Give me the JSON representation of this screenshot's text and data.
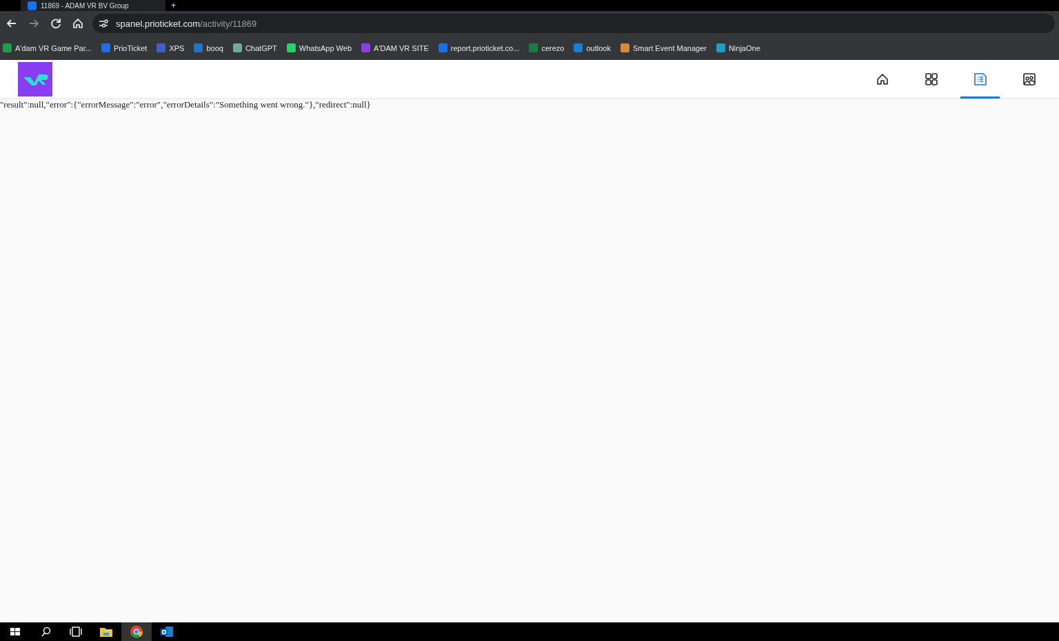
{
  "browser": {
    "tab_title": "11869 - ADAM VR BV Group",
    "tab_new": "+",
    "url_host": "spanel.prioticket.com",
    "url_path": "/activity/11869",
    "bookmarks": [
      {
        "label": "A'dam VR Game Par...",
        "color": "#1e9e4a"
      },
      {
        "label": "PrioTicket",
        "color": "#1a6ff0"
      },
      {
        "label": "XPS",
        "color": "#3f5fcf"
      },
      {
        "label": "booq",
        "color": "#1f73c9"
      },
      {
        "label": "ChatGPT",
        "color": "#74aa9c"
      },
      {
        "label": "WhatsApp Web",
        "color": "#25d366"
      },
      {
        "label": "A'DAM VR SITE",
        "color": "#8a3cf0"
      },
      {
        "label": "report.prioticket.co...",
        "color": "#1a6ff0"
      },
      {
        "label": "cerezo",
        "color": "#1d7a44"
      },
      {
        "label": "outlook",
        "color": "#1480d8"
      },
      {
        "label": "Smart Event Manager",
        "color": "#d78a3a"
      },
      {
        "label": "NinjaOne",
        "color": "#1aa0c8"
      }
    ]
  },
  "app": {
    "nav": [
      {
        "selected": false
      },
      {
        "selected": false
      },
      {
        "selected": true
      },
      {
        "selected": false
      }
    ],
    "body_text": "\"result\":null,\"error\":{\"errorMessage\":\"error\",\"errorDetails\":\"Something went wrong.\"},\"redirect\":null}"
  }
}
